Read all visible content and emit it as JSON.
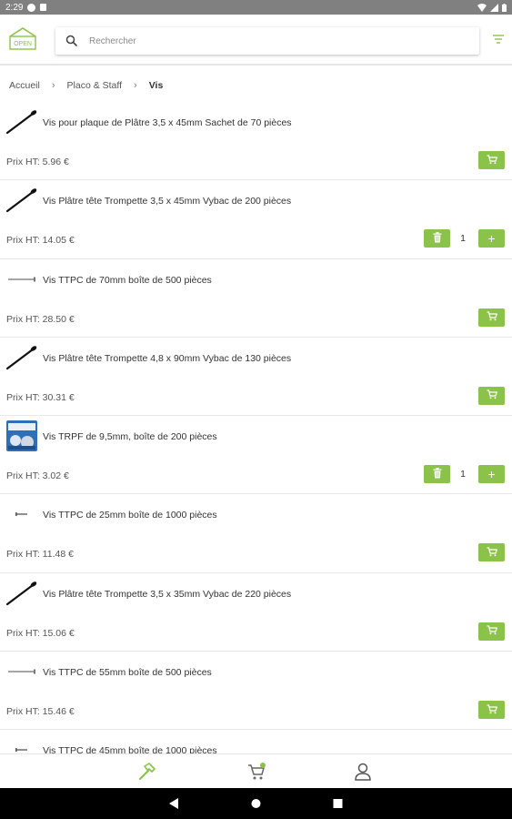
{
  "status_bar": {
    "time": "2:29"
  },
  "header": {
    "logo_text": "OPEN",
    "search_placeholder": "Rechercher",
    "accent": "#8bc34a"
  },
  "breadcrumb": {
    "items": [
      "Accueil",
      "Placo & Staff",
      "Vis"
    ]
  },
  "products": [
    {
      "name": "Vis pour plaque de Plâtre 3,5 x 45mm Sachet de 70 pièces",
      "price": "Prix HT: 5.96 €",
      "thumb": "black-screw",
      "in_cart": false
    },
    {
      "name": "Vis Plâtre tête Trompette 3,5 x 45mm Vybac de 200 pièces",
      "price": "Prix HT: 14.05 €",
      "thumb": "black-screw",
      "in_cart": true,
      "qty": "1"
    },
    {
      "name": "Vis TTPC de 70mm boîte de 500 pièces",
      "price": "Prix HT: 28.50 €",
      "thumb": "silver-screw",
      "in_cart": false
    },
    {
      "name": "Vis Plâtre tête Trompette 4,8 x 90mm Vybac de 130 pièces",
      "price": "Prix HT: 30.31 €",
      "thumb": "black-screw",
      "in_cart": false
    },
    {
      "name": "Vis TRPF de 9,5mm, boîte de 200 pièces",
      "price": "Prix HT: 3.02 €",
      "thumb": "screw-box",
      "in_cart": true,
      "qty": "1"
    },
    {
      "name": "Vis TTPC de 25mm boîte de 1000 pièces",
      "price": "Prix HT: 11.48 €",
      "thumb": "small-screw",
      "in_cart": false
    },
    {
      "name": "Vis Plâtre tête Trompette 3,5 x 35mm Vybac de 220 pièces",
      "price": "Prix HT: 15.06 €",
      "thumb": "black-screw",
      "in_cart": false
    },
    {
      "name": "Vis TTPC de 55mm boîte de 500 pièces",
      "price": "Prix HT: 15.46 €",
      "thumb": "silver-screw",
      "in_cart": false
    },
    {
      "name": "Vis TTPC de 45mm boîte de 1000 pièces",
      "price": "",
      "thumb": "small-screw",
      "in_cart": false
    }
  ],
  "bottom_nav": {
    "items": [
      "hammer-icon",
      "cart-icon",
      "account-icon"
    ],
    "active": "hammer-icon"
  }
}
